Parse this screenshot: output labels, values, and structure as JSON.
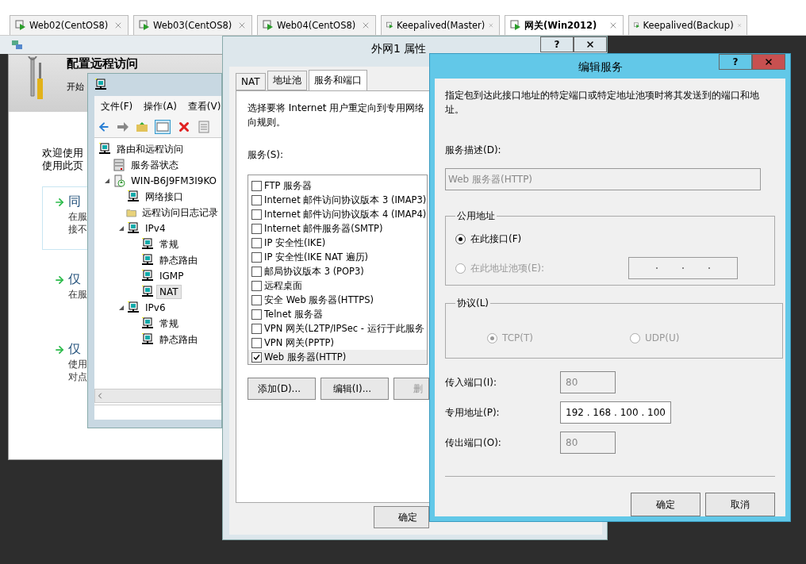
{
  "tabs": [
    {
      "label": "Web02(CentOS8)",
      "selected": false
    },
    {
      "label": "Web03(CentOS8)",
      "selected": false
    },
    {
      "label": "Web04(CentOS8)",
      "selected": false
    },
    {
      "label": "Keepalived(Master)",
      "selected": false
    },
    {
      "label": "网关(Win2012)",
      "selected": true
    },
    {
      "label": "Keepalived(Backup)",
      "selected": false
    }
  ],
  "main_window": {
    "title": "配置远程访问",
    "subtitle": "开始",
    "intro": [
      "欢迎使用",
      "使用此页"
    ],
    "options": [
      {
        "title": "同",
        "lines": [
          "在服",
          "接不"
        ],
        "highlighted": true
      },
      {
        "title": "仅",
        "lines": [
          "在服"
        ],
        "highlighted": false
      },
      {
        "title": "仅",
        "lines": [
          "使用",
          "对点"
        ],
        "highlighted": false
      }
    ]
  },
  "mmc": {
    "menu": [
      "文件(F)",
      "操作(A)",
      "查看(V)"
    ],
    "tree": [
      {
        "label": "路由和远程访问",
        "kind": "node",
        "selected": false,
        "children": [
          {
            "label": "服务器状态",
            "kind": "status",
            "selected": false
          },
          {
            "label": "WIN-B6J9FM3I9KO",
            "kind": "server",
            "selected": false,
            "expanded": true,
            "children": [
              {
                "label": "网络接口",
                "kind": "node",
                "selected": false
              },
              {
                "label": "远程访问日志记录",
                "kind": "folder",
                "selected": false
              },
              {
                "label": "IPv4",
                "kind": "node",
                "selected": false,
                "expanded": true,
                "children": [
                  {
                    "label": "常规",
                    "kind": "node",
                    "selected": false
                  },
                  {
                    "label": "静态路由",
                    "kind": "node",
                    "selected": false
                  },
                  {
                    "label": "IGMP",
                    "kind": "node",
                    "selected": false
                  },
                  {
                    "label": "NAT",
                    "kind": "node",
                    "selected": true
                  }
                ]
              },
              {
                "label": "IPv6",
                "kind": "node",
                "selected": false,
                "expanded": true,
                "children": [
                  {
                    "label": "常规",
                    "kind": "node",
                    "selected": false
                  },
                  {
                    "label": "静态路由",
                    "kind": "node",
                    "selected": false
                  }
                ]
              }
            ]
          }
        ]
      }
    ]
  },
  "properties": {
    "title": "外网1 属性",
    "tabs": [
      {
        "label": "NAT",
        "selected": false
      },
      {
        "label": "地址池",
        "selected": false
      },
      {
        "label": "服务和端口",
        "selected": true
      }
    ],
    "help": "?",
    "description": [
      "选择要将 Internet 用户重定向到专用网络",
      "向规则。"
    ],
    "services_label": "服务(S):",
    "services": [
      {
        "label": "FTP 服务器",
        "checked": false,
        "selected": false
      },
      {
        "label": "Internet 邮件访问协议版本 3 (IMAP3)",
        "checked": false,
        "selected": false
      },
      {
        "label": "Internet 邮件访问协议版本 4 (IMAP4)",
        "checked": false,
        "selected": false
      },
      {
        "label": "Internet 邮件服务器(SMTP)",
        "checked": false,
        "selected": false
      },
      {
        "label": "IP 安全性(IKE)",
        "checked": false,
        "selected": false
      },
      {
        "label": "IP 安全性(IKE NAT 遍历)",
        "checked": false,
        "selected": false
      },
      {
        "label": "邮局协议版本 3 (POP3)",
        "checked": false,
        "selected": false
      },
      {
        "label": "远程桌面",
        "checked": false,
        "selected": false
      },
      {
        "label": "安全 Web 服务器(HTTPS)",
        "checked": false,
        "selected": false
      },
      {
        "label": "Telnet 服务器",
        "checked": false,
        "selected": false
      },
      {
        "label": "VPN 网关(L2TP/IPSec - 运行于此服务",
        "checked": false,
        "selected": false
      },
      {
        "label": "VPN 网关(PPTP)",
        "checked": false,
        "selected": false
      },
      {
        "label": "Web 服务器(HTTP)",
        "checked": true,
        "selected": true
      }
    ],
    "buttons": [
      {
        "label": "添加(D)...",
        "disabled": false
      },
      {
        "label": "编辑(I)...",
        "disabled": false
      },
      {
        "label": "删",
        "disabled": true
      }
    ],
    "ok": "确定"
  },
  "edit_service": {
    "title": "编辑服务",
    "help": "?",
    "description": "指定包到达此接口地址的特定端口或特定地址池项时将其发送到的端口和地址。",
    "desc_label": "服务描述(D):",
    "desc_value": "Web 服务器(HTTP)",
    "public_group": {
      "title": "公用地址",
      "options": [
        {
          "label": "在此接口(F)",
          "selected": true,
          "disabled": false
        },
        {
          "label": "在此地址池项(E):",
          "selected": false,
          "disabled": true
        }
      ]
    },
    "protocol_group": {
      "title": "协议(L)",
      "options": [
        {
          "label": "TCP(T)",
          "selected": true,
          "disabled": true
        },
        {
          "label": "UDP(U)",
          "selected": false,
          "disabled": true
        }
      ]
    },
    "fields": [
      {
        "label": "传入端口(I):",
        "value": "80",
        "disabled": true
      },
      {
        "label": "专用地址(P):",
        "value": "192 . 168 . 100 . 100",
        "disabled": false
      },
      {
        "label": "传出端口(O):",
        "value": "80",
        "disabled": true
      }
    ],
    "buttons": [
      "确定",
      "取消"
    ]
  }
}
